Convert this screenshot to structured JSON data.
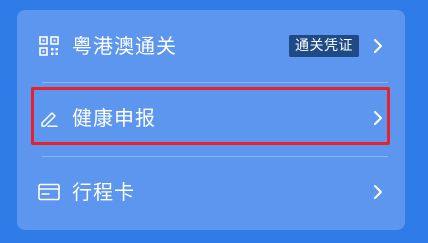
{
  "menu": {
    "items": [
      {
        "label": "粤港澳通关",
        "icon": "qr-code-icon",
        "badge": "通关凭证"
      },
      {
        "label": "健康申报",
        "icon": "edit-pen-icon"
      },
      {
        "label": "行程卡",
        "icon": "card-icon"
      }
    ]
  },
  "colors": {
    "background": "#2f7be8",
    "card": "#5d96ee",
    "badge": "#1e4a86",
    "highlight": "#e8222b"
  }
}
